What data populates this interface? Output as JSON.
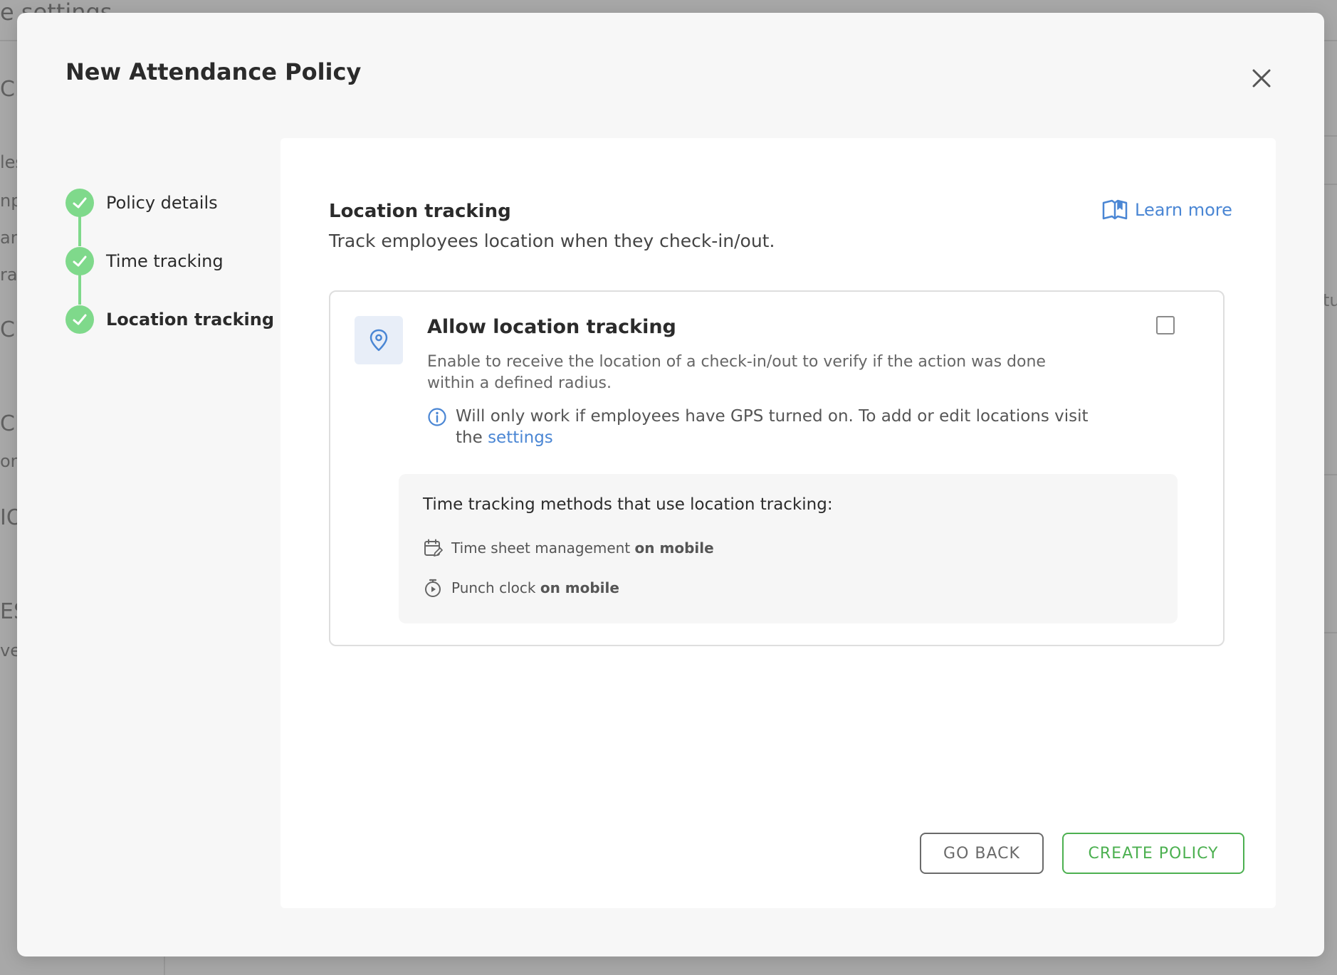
{
  "background": {
    "title_fragment": "e settings",
    "left_fragments": [
      "CI",
      "les",
      "np",
      "arg",
      "rac",
      "CI",
      "CI",
      "on",
      "IO",
      "ES",
      "ver"
    ],
    "right_fragment": "tu"
  },
  "modal": {
    "title": "New Attendance Policy",
    "close_icon": "close-icon"
  },
  "stepper": {
    "steps": [
      {
        "label": "Policy details",
        "status": "complete"
      },
      {
        "label": "Time tracking",
        "status": "complete"
      },
      {
        "label": "Location tracking",
        "status": "complete",
        "active": true
      }
    ],
    "check_icon": "check-icon",
    "complete_color": "#7fd98b"
  },
  "section": {
    "title": "Location tracking",
    "subtitle": "Track employees location when they check-in/out.",
    "learn_more": "Learn more",
    "learn_more_icon": "book-icon"
  },
  "option": {
    "icon": "map-pin-icon",
    "title": "Allow location tracking",
    "description": "Enable to receive the location of a check-in/out to verify if the action was done within a defined radius.",
    "checked": false,
    "info_text": "Will only work if employees have GPS turned on. To add or edit locations visit the ",
    "info_link": "settings",
    "info_icon": "info-icon"
  },
  "methods": {
    "title": "Time tracking methods that use location tracking:",
    "items": [
      {
        "icon": "calendar-edit-icon",
        "text": "Time sheet management ",
        "suffix": "on mobile"
      },
      {
        "icon": "stopwatch-icon",
        "text": "Punch clock ",
        "suffix": "on mobile"
      }
    ]
  },
  "footer": {
    "back_label": "GO BACK",
    "create_label": "CREATE POLICY"
  },
  "colors": {
    "accent_blue": "#4a86d4",
    "success_green": "#4cb050",
    "step_green": "#7fd98b"
  }
}
